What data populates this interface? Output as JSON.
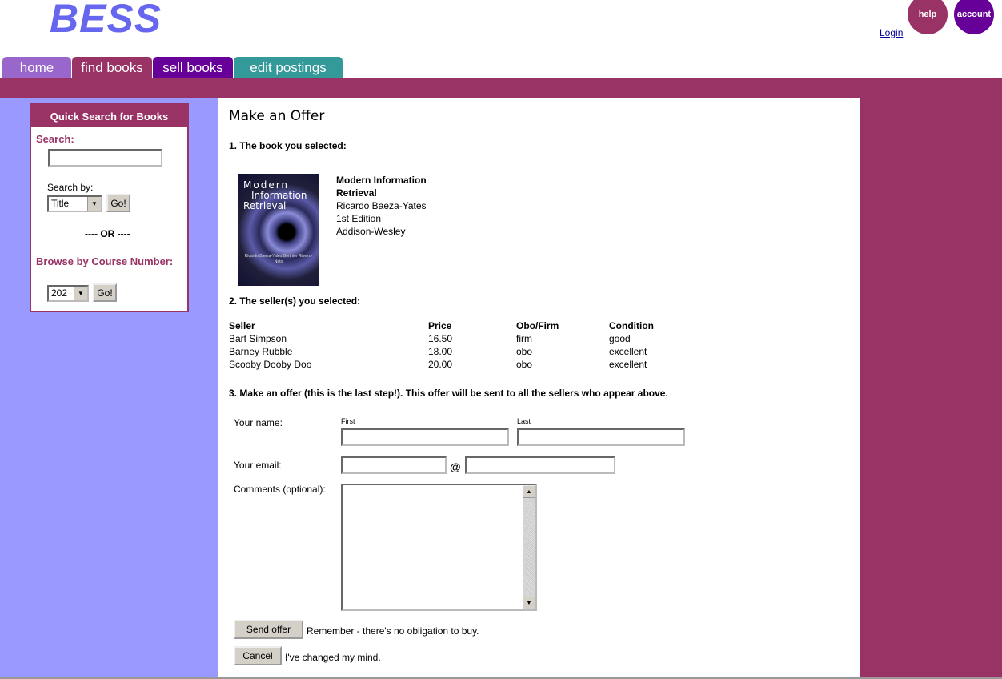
{
  "header": {
    "logo": "BESS",
    "help_label": "help",
    "account_label": "account",
    "login_label": "Login"
  },
  "tabs": [
    {
      "label": "home"
    },
    {
      "label": "find books"
    },
    {
      "label": "sell books"
    },
    {
      "label": "edit postings"
    }
  ],
  "quick_search": {
    "title": "Quick Search for Books",
    "search_label": "Search:",
    "search_value": "",
    "search_by_label": "Search by:",
    "search_by_value": "Title",
    "go_label": "Go!",
    "or_label": "---- OR ----",
    "browse_label": "Browse by Course Number:",
    "course_value": "202",
    "go2_label": "Go!"
  },
  "offer": {
    "title": "Make an Offer",
    "step1": "1. The book you selected:",
    "book": {
      "title_line1": "Modern Information",
      "title_line2": "Retrieval",
      "author": "Ricardo Baeza-Yates",
      "edition": "1st Edition",
      "publisher": "Addison-Wesley",
      "cover_line1": "Modern",
      "cover_line2": "Information",
      "cover_line3": "Retrieval",
      "cover_authors": "Ricardo Baeza-Yates Berthier Ribeiro-Neto"
    },
    "step2": "2. The seller(s) you selected:",
    "sellers_table": {
      "headers": [
        "Seller",
        "Price",
        "Obo/Firm",
        "Condition"
      ],
      "rows": [
        [
          "Bart Simpson",
          "16.50",
          "firm",
          "good"
        ],
        [
          "Barney Rubble",
          "18.00",
          "obo",
          "excellent"
        ],
        [
          "Scooby Dooby Doo",
          "20.00",
          "obo",
          "excellent"
        ]
      ]
    },
    "step3": "3. Make an offer (this is the last step!). This offer will be sent to all the sellers who appear above.",
    "form": {
      "name_label": "Your name:",
      "first_label": "First",
      "last_label": "Last",
      "first_value": "",
      "last_value": "",
      "email_label": "Your email:",
      "at_sign": "@",
      "email_user_value": "",
      "email_domain_value": "",
      "comments_label": "Comments (optional):",
      "send_label": "Send offer",
      "send_note": "Remember - there's no obligation to buy.",
      "cancel_label": "Cancel",
      "cancel_note": "I've changed my mind."
    }
  }
}
